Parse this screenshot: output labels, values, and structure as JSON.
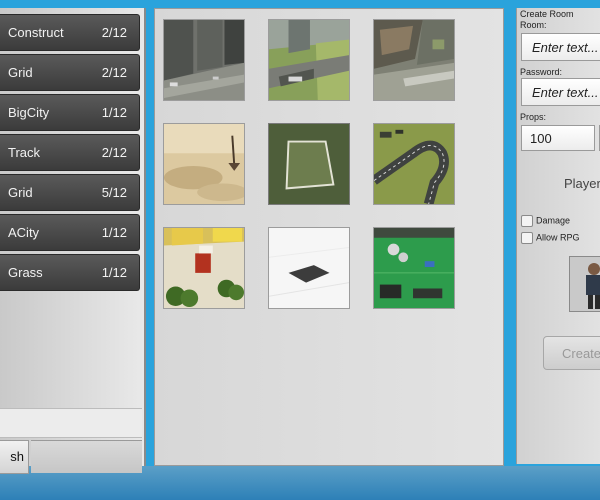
{
  "rooms": [
    {
      "name": "Construct",
      "count": "2/12"
    },
    {
      "name": "Grid",
      "count": "2/12"
    },
    {
      "name": "BigCity",
      "count": "1/12"
    },
    {
      "name": "Track",
      "count": "2/12"
    },
    {
      "name": "Grid",
      "count": "5/12"
    },
    {
      "name": "ACity",
      "count": "1/12"
    },
    {
      "name": "Grass",
      "count": "1/12"
    }
  ],
  "left_footer": {
    "refresh_label": "sh"
  },
  "maps": [
    {
      "icon": "city-street-map-thumbnail"
    },
    {
      "icon": "city-buildings-map-thumbnail"
    },
    {
      "icon": "city-block-map-thumbnail"
    },
    {
      "icon": "desert-map-thumbnail"
    },
    {
      "icon": "grid-pad-map-thumbnail"
    },
    {
      "icon": "race-track-map-thumbnail"
    },
    {
      "icon": "town-square-map-thumbnail"
    },
    {
      "icon": "empty-white-map-thumbnail"
    },
    {
      "icon": "grass-town-map-thumbnail"
    }
  ],
  "create_room": {
    "title": "Create Room",
    "room_label": "Room:",
    "room_placeholder": "Enter text...",
    "password_label": "Password:",
    "password_placeholder": "Enter text...",
    "props_label": "Props:",
    "props_value": "100",
    "players_label": "Player",
    "damage_label": "Damage",
    "allow_rpg_label": "Allow RPG",
    "create_label": "Create"
  },
  "colors": {
    "background": "#2aa3dc",
    "room_row": "#4a4a4a"
  }
}
